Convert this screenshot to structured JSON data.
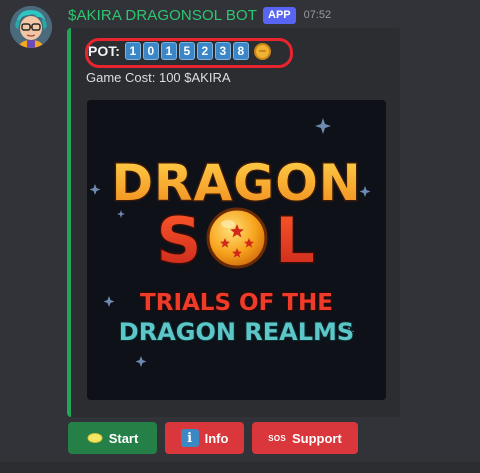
{
  "message": {
    "username": "$AKIRA DRAGONSOL BOT",
    "badge": "APP",
    "time": "07:52"
  },
  "embed": {
    "pot_label": "POT:",
    "pot_digits": [
      "1",
      "0",
      "1",
      "5",
      "2",
      "3",
      "8"
    ],
    "game_cost": "Game Cost: 100 $AKIRA",
    "accent_color": "#23a559",
    "image": {
      "title_line1": "DRAGON",
      "title_line2_left": "S",
      "title_line2_right": "L",
      "subtitle_line1": "TRIALS OF THE",
      "subtitle_line2": "DRAGON REALMS"
    }
  },
  "buttons": {
    "start": {
      "label": "Start",
      "icon": "lemon-icon"
    },
    "info": {
      "label": "Info",
      "icon_glyph": "i"
    },
    "support": {
      "label": "Support",
      "icon_glyph": "SOS"
    }
  }
}
